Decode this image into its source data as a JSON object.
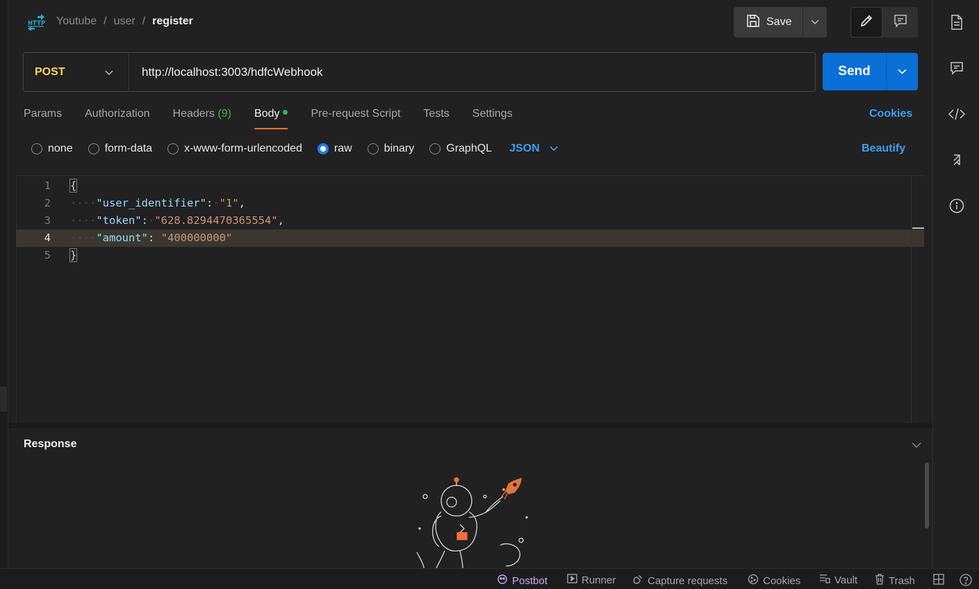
{
  "header": {
    "icon_name": "http-request-icon",
    "breadcrumb": [
      "Youtube",
      "user",
      "register"
    ],
    "separator": "/",
    "save_label": "Save"
  },
  "request": {
    "method": "POST",
    "url": "http://localhost:3003/hdfcWebhook",
    "send_label": "Send"
  },
  "tabs": {
    "params": "Params",
    "authorization": "Authorization",
    "headers": "Headers",
    "headers_count": "(9)",
    "body": "Body",
    "pre_request": "Pre-request Script",
    "tests": "Tests",
    "settings": "Settings",
    "active": "Body",
    "cookies": "Cookies"
  },
  "body_types": {
    "none": "none",
    "form_data": "form-data",
    "urlencoded": "x-www-form-urlencoded",
    "raw": "raw",
    "binary": "binary",
    "graphql": "GraphQL",
    "selected": "raw",
    "language": "JSON",
    "beautify": "Beautify"
  },
  "editor": {
    "line_numbers": [
      "1",
      "2",
      "3",
      "4",
      "5"
    ],
    "current_line": "4",
    "key_user_identifier": "\"user_identifier\"",
    "val_user_identifier": "\"1\"",
    "key_token": "\"token\"",
    "val_token": "\"628.8294470365554\"",
    "key_amount": "\"amount\"",
    "val_amount": "\"400000000\"",
    "open_brace": "{",
    "close_brace": "}",
    "colon": ":",
    "comma": ",",
    "indent": "····",
    "space_dot": "·"
  },
  "response": {
    "title": "Response"
  },
  "footer": {
    "postbot": "Postbot",
    "runner": "Runner",
    "capture": "Capture requests",
    "cookies": "Cookies",
    "vault": "Vault",
    "trash": "Trash"
  },
  "colors": {
    "accent": "#0a6fd6",
    "method": "#ffd65c",
    "link": "#3e9df5",
    "active_tab": "#ff6c37",
    "status_dot": "#2fb35b"
  }
}
